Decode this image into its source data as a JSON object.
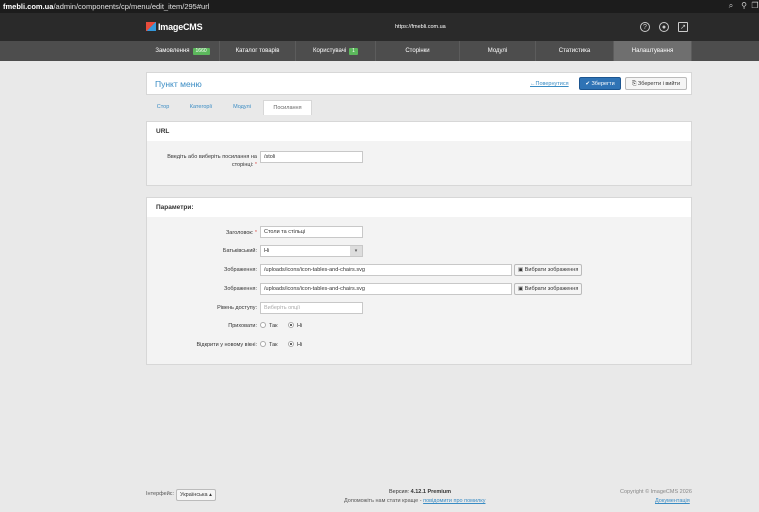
{
  "browser": {
    "url_host": "fmebli.com.ua",
    "url_path": "/admin/components/cp/menu/edit_item/295#url"
  },
  "header": {
    "logo": "ImageCMS",
    "site_url": "https://fmebli.com.ua"
  },
  "nav": [
    {
      "label": "Замовлення",
      "badge": "1660"
    },
    {
      "label": "Каталог товарів"
    },
    {
      "label": "Користувачі",
      "badge": "1"
    },
    {
      "label": "Сторінки"
    },
    {
      "label": "Модулі"
    },
    {
      "label": "Статистика"
    },
    {
      "label": "Налаштування"
    }
  ],
  "page": {
    "title": "Пункт меню",
    "back": "←Повернутися",
    "save": "Зберегти",
    "save_exit": "Зберегти і вийти"
  },
  "tabs": [
    "Стор",
    "Категорії",
    "Модулі",
    "Посилання"
  ],
  "url_panel": {
    "heading": "URL",
    "label": "Введіть або виберіть посилання на сторінці:",
    "required": "*",
    "value": "/stoli"
  },
  "params": {
    "heading": "Параметри:",
    "title_label": "Заголовок:",
    "title_value": "Столи та стільці",
    "parent_label": "Батьківський:",
    "parent_value": "Ні",
    "image_label": "Зображення:",
    "image_value": "/uploads/icons/icon-tables-and-chairs.svg",
    "image_btn": "Вибрати зображення",
    "image2_label": "Зображення:",
    "image2_value": "/uploads/icons/icon-tables-and-chairs.svg",
    "image2_btn": "Вибрати зображення",
    "access_label": "Рівень доступу:",
    "access_placeholder": "Виберіть опції",
    "hide_label": "Приховати:",
    "hide_yes": "Так",
    "hide_no": "Ні",
    "newwin_label": "Відкрити у новому вікні:",
    "newwin_yes": "Так",
    "newwin_no": "Ні"
  },
  "footer": {
    "interface_label": "Інтерфейс:",
    "language": "Українська ▴",
    "version_prefix": "Версия: ",
    "version": "4.12.1 Premium",
    "help_text": "Допоможіть нам стати краще - ",
    "help_link": "повідомити про помилку",
    "copyright": "Copyright © ImageCMS 2026",
    "docs": "Документація"
  }
}
